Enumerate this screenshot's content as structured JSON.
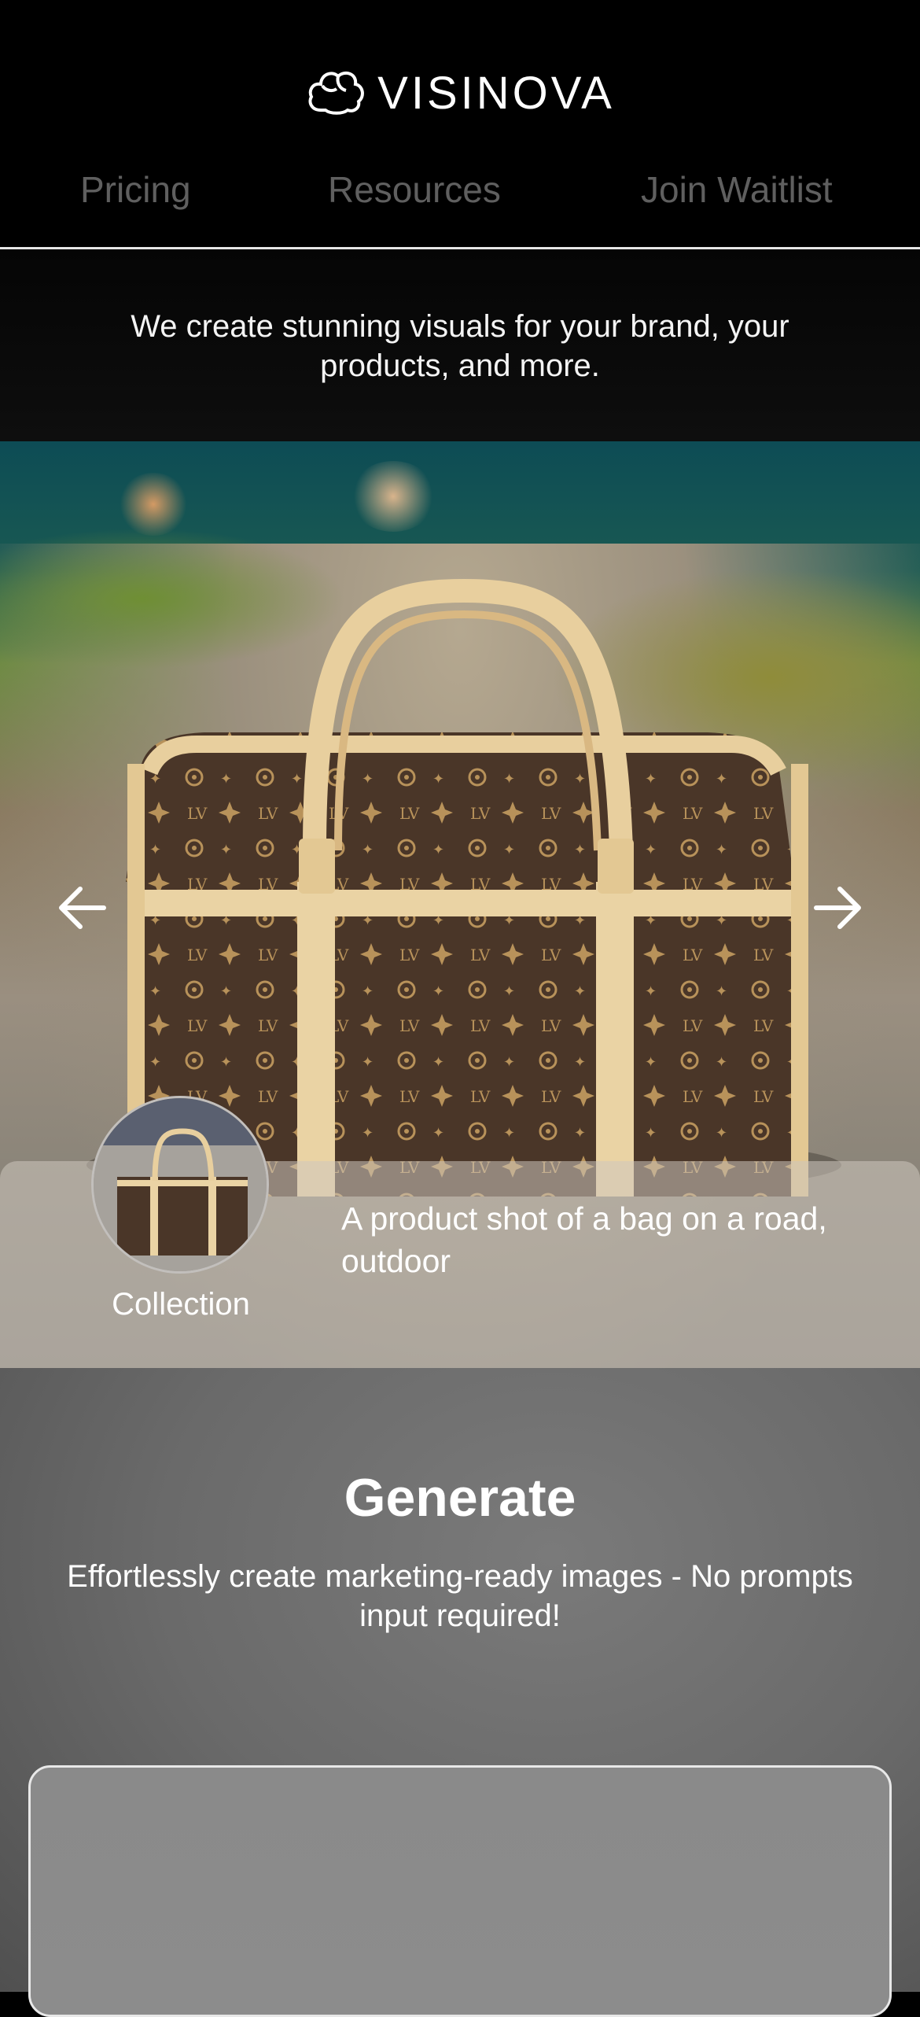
{
  "brand": {
    "name": "VISINOVA",
    "logo_icon": "cloud-icon"
  },
  "nav": {
    "items": [
      {
        "label": "Pricing"
      },
      {
        "label": "Resources"
      },
      {
        "label": "Join Waitlist"
      }
    ]
  },
  "tagline": "We create stunning visuals for your brand, your products, and more.",
  "hero": {
    "image_description_icon": "bag-product-photo",
    "prev_icon": "arrow-left-icon",
    "next_icon": "arrow-right-icon",
    "thumbnail_label": "Collection",
    "caption": "A product shot of a bag on a road, outdoor"
  },
  "generate": {
    "title": "Generate",
    "subtitle": "Effortlessly create marketing-ready images - No prompts input required!"
  },
  "colors": {
    "background": "#000000",
    "nav_text": "#5f5f5f",
    "divider": "#e6e6e6",
    "text": "#ffffff"
  }
}
